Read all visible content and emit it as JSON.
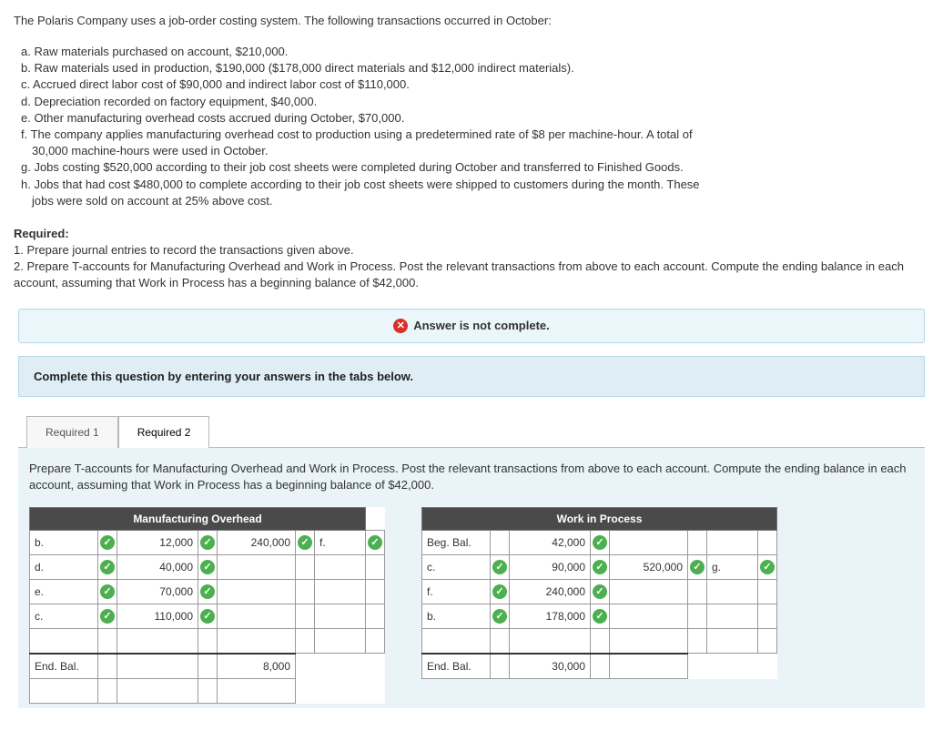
{
  "intro": "The Polaris Company uses a job-order costing system. The following transactions occurred in October:",
  "transactions": {
    "a": "a. Raw materials purchased on account, $210,000.",
    "b": "b. Raw materials used in production, $190,000 ($178,000 direct materials and $12,000 indirect materials).",
    "c": "c. Accrued direct labor cost of $90,000 and indirect labor cost of $110,000.",
    "d": "d. Depreciation recorded on factory equipment, $40,000.",
    "e": "e. Other manufacturing overhead costs accrued during October, $70,000.",
    "f1": "f. The company applies manufacturing overhead cost to production using a predetermined rate of $8 per machine-hour. A total of",
    "f2": "30,000 machine-hours were used in October.",
    "g": "g. Jobs costing $520,000 according to their job cost sheets were completed during October and transferred to Finished Goods.",
    "h1": "h. Jobs that had cost $480,000 to complete according to their job cost sheets were shipped to customers during the month. These",
    "h2": "jobs were sold on account at 25% above cost."
  },
  "required": {
    "hdr": "Required:",
    "r1": "1. Prepare journal entries to record the transactions given above.",
    "r2": "2. Prepare T-accounts for Manufacturing Overhead and Work in Process. Post the relevant transactions from above to each account. Compute the ending balance in each account, assuming that Work in Process has a beginning balance of $42,000."
  },
  "alert": "Answer is not complete.",
  "tabs_instr": "Complete this question by entering your answers in the tabs below.",
  "tabs": {
    "t1": "Required 1",
    "t2": "Required 2"
  },
  "tab_prompt": "Prepare T-accounts for Manufacturing Overhead and Work in Process. Post the relevant transactions from above to each account. Compute the ending balance in each account, assuming that Work in Process has a beginning balance of $42,000.",
  "moh": {
    "title": "Manufacturing Overhead",
    "rows": [
      {
        "l": "b.",
        "la": "12,000",
        "ra": "240,000",
        "r": "f."
      },
      {
        "l": "d.",
        "la": "40,000",
        "ra": "",
        "r": ""
      },
      {
        "l": "e.",
        "la": "70,000",
        "ra": "",
        "r": ""
      },
      {
        "l": "c.",
        "la": "110,000",
        "ra": "",
        "r": ""
      }
    ],
    "end_label": "End. Bal.",
    "end_left": "",
    "end_right": "8,000"
  },
  "wip": {
    "title": "Work in Process",
    "rows": [
      {
        "l": "Beg. Bal.",
        "lc": false,
        "la": "42,000",
        "ra": "",
        "r": "",
        "rc": false
      },
      {
        "l": "c.",
        "lc": true,
        "la": "90,000",
        "ra": "520,000",
        "r": "g.",
        "rc": true
      },
      {
        "l": "f.",
        "lc": true,
        "la": "240,000",
        "ra": "",
        "r": "",
        "rc": false
      },
      {
        "l": "b.",
        "lc": true,
        "la": "178,000",
        "ra": "",
        "r": "",
        "rc": false
      }
    ],
    "end_label": "End. Bal.",
    "end_left": "30,000",
    "end_right": ""
  }
}
